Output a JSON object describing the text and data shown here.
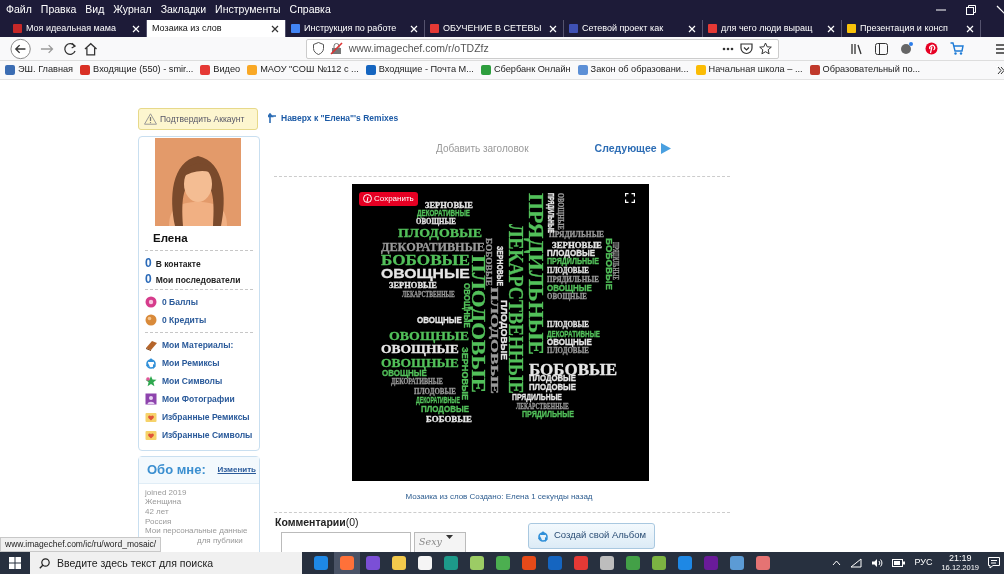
{
  "menu_bar": {
    "items": [
      "Файл",
      "Правка",
      "Вид",
      "Журнал",
      "Закладки",
      "Инструменты",
      "Справка"
    ]
  },
  "tabs": [
    {
      "label": "Моя идеальная мама",
      "selected": false,
      "color": "#c62828"
    },
    {
      "label": "Мозаика из слов",
      "selected": true
    },
    {
      "label": "Инструкция по работе",
      "selected": false,
      "color": "#4285f4"
    },
    {
      "label": "ОБУЧЕНИЕ В СЕТЕВЫ",
      "selected": false,
      "color": "#e53935"
    },
    {
      "label": "Сетевой проект как",
      "selected": false,
      "color": "#3f51b5"
    },
    {
      "label": "для чего люди выращ",
      "selected": false,
      "color": "#e53935"
    },
    {
      "label": "Презентация и консп",
      "selected": false,
      "color": "#f9c20a"
    }
  ],
  "address_bar": {
    "url": "www.imagechef.com/r/oTDZfz"
  },
  "bookmarks": [
    {
      "label": "ЭШ. Главная",
      "color": "#3b6db3"
    },
    {
      "label": "Входящие (550) - smir...",
      "color": "#d93025"
    },
    {
      "label": "Видео",
      "color": "#e53935"
    },
    {
      "label": "МАОУ \"СОШ №112 с ...",
      "color": "#f9a825"
    },
    {
      "label": "Входящие - Почта M...",
      "color": "#1565c0"
    },
    {
      "label": "Сбербанк Онлайн",
      "color": "#2e9e3e"
    },
    {
      "label": "Закон об образовани...",
      "color": "#5c8fd6"
    },
    {
      "label": "Начальная школа – ...",
      "color": "#fbbc04"
    },
    {
      "label": "Образовательный по...",
      "color": "#c0392b"
    }
  ],
  "sidebar": {
    "confirm_button": "Подтвердить Аккаунт",
    "profile": {
      "name": "Елена",
      "stats": [
        {
          "count": "0",
          "label": "В контакте"
        },
        {
          "count": "0",
          "label": "Мои последователи"
        }
      ],
      "points": [
        "0 Баллы",
        "0 Кредиты"
      ],
      "links": [
        "Мои Материалы:",
        "Мои Ремиксы",
        "Мои Символы",
        "Мои Фотографии",
        "Избранные Ремиксы",
        "Избранные Символы"
      ]
    },
    "about": {
      "title": "Обо мне:",
      "edit": "Изменить",
      "lines": [
        "joined 2019",
        "Женщина",
        "42 лет",
        "Россия",
        "Мои персональные данные",
        "для публики"
      ]
    }
  },
  "main": {
    "back_link": "Наверх к \"Елена\"'s Remixes",
    "add_title": "Добавить заголовок",
    "next_link": "Следующее",
    "mosaic": {
      "save_button": "Сохранить",
      "words": [
        {
          "text": "ЗЕРНОВЫЕ",
          "kind": "serif",
          "color": "#e6e6e6"
        },
        {
          "text": "ДЕКОРАТИВНЫЕ",
          "kind": "sans",
          "color": "#52c05a"
        },
        {
          "text": "ОВОЩНЫЕ",
          "kind": "serif",
          "color": "#e6e6e6"
        },
        {
          "text": "ПЛОДОВЫЕ",
          "kind": "serif",
          "color": "#52c05a"
        },
        {
          "text": "ДЕКОРАТИВНЫЕ",
          "kind": "serif",
          "color": "#9a9a9a"
        },
        {
          "text": "БОБОВЫЕ",
          "kind": "serif",
          "color": "#52c05a"
        },
        {
          "text": "ОВОЩНЫЕ",
          "kind": "sans",
          "color": "#e6e6e6"
        },
        {
          "text": "ЗЕРНОВЫЕ",
          "kind": "serif",
          "color": "#e6e6e6"
        },
        {
          "text": "ЛЕКАРСТВЕННЫЕ",
          "kind": "serif",
          "color": "#9a9a9a"
        },
        {
          "text": "ОВОЩНЫЕ",
          "kind": "sans",
          "color": "#e6e6e6"
        },
        {
          "text": "ОВОЩНЫЕ",
          "kind": "serif",
          "color": "#52c05a"
        },
        {
          "text": "ОВОЩНЫЕ",
          "kind": "serif",
          "color": "#e6e6e6"
        },
        {
          "text": "ОВОЩНЫЕ",
          "kind": "serif",
          "color": "#52c05a"
        },
        {
          "text": "ОВОЩНЫЕ",
          "kind": "sans",
          "color": "#52c05a"
        },
        {
          "text": "ДЕКОРАТИВНЫЕ",
          "kind": "serif",
          "color": "#9a9a9a"
        },
        {
          "text": "ПЛОДОВЫЕ",
          "kind": "serif",
          "color": "#9a9a9a"
        },
        {
          "text": "ДЕКОРАТИВНЫЕ",
          "kind": "sans",
          "color": "#52c05a"
        },
        {
          "text": "ПЛОДОВЫЕ",
          "kind": "sans",
          "color": "#52c05a"
        },
        {
          "text": "БОБОВЫЕ",
          "kind": "serif",
          "color": "#e6e6e6"
        },
        {
          "text": "ПРЯДИЛЬНЫЕ",
          "kind": "serif",
          "color": "#9a9a9a"
        },
        {
          "text": "ЗЕРНОВЫЕ",
          "kind": "serif",
          "color": "#e6e6e6"
        },
        {
          "text": "ПЛОДОВЫЕ",
          "kind": "sans",
          "color": "#e6e6e6"
        },
        {
          "text": "ПРЯДИЛЬНЫЕ",
          "kind": "sans",
          "color": "#52c05a"
        },
        {
          "text": "ПЛОДОВЫЕ",
          "kind": "serif",
          "color": "#e6e6e6"
        },
        {
          "text": "ПРЯДИЛЬНЫЕ",
          "kind": "serif",
          "color": "#9a9a9a"
        },
        {
          "text": "ОВОЩНЫЕ",
          "kind": "sans",
          "color": "#52c05a"
        },
        {
          "text": "ОВОЩНЫЕ",
          "kind": "serif",
          "color": "#9a9a9a"
        },
        {
          "text": "ПЛОДОВЫЕ",
          "kind": "serif",
          "color": "#e6e6e6"
        },
        {
          "text": "ДЕКОРАТИВНЫЕ",
          "kind": "sans",
          "color": "#52c05a"
        },
        {
          "text": "ОВОЩНЫЕ",
          "kind": "sans",
          "color": "#e6e6e6"
        },
        {
          "text": "ПЛОДОВЫЕ",
          "kind": "serif",
          "color": "#9a9a9a"
        },
        {
          "text": "БОБОВЫЕ",
          "kind": "serif",
          "color": "#e6e6e6"
        },
        {
          "text": "ПЛОДОВЫЕ",
          "kind": "sans",
          "color": "#e6e6e6"
        },
        {
          "text": "ПЛОДОВЫЕ",
          "kind": "sans",
          "color": "#e6e6e6"
        },
        {
          "text": "ПРЯДИЛЬНЫЕ",
          "kind": "sans",
          "color": "#e6e6e6"
        },
        {
          "text": "ЛЕКАРСТВЕННЫЕ",
          "kind": "serif",
          "color": "#9a9a9a"
        },
        {
          "text": "ПРЯДИЛЬНЫЕ",
          "kind": "sans",
          "color": "#52c05a"
        },
        {
          "text": "ПЛОДОВЫЕ",
          "kind": "serif-vertical",
          "color": "#52c05a"
        },
        {
          "text": "ПЛОДОВЫЕ",
          "kind": "serif-vertical",
          "color": "#9a9a9a"
        },
        {
          "text": "БОБОВЫЕ",
          "kind": "serif-vertical",
          "color": "#9a9a9a"
        },
        {
          "text": "ЗЕРНОВЫЕ",
          "kind": "sans-vertical",
          "color": "#e6e6e6"
        },
        {
          "text": "ОВОЩНЫЕ",
          "kind": "sans-vertical",
          "color": "#52c05a"
        },
        {
          "text": "ЗЕРНОВЫЕ",
          "kind": "sans-vertical",
          "color": "#52c05a"
        },
        {
          "text": "ПЛОДОВЫЕ",
          "kind": "sans-vertical",
          "color": "#e6e6e6"
        },
        {
          "text": "ЛЕКАРСТВЕННЫЕ",
          "kind": "serif-vertical",
          "color": "#52c05a"
        },
        {
          "text": "ПРЯДИЛЬНЫЕ",
          "kind": "serif-vertical",
          "color": "#52c05a"
        },
        {
          "text": "ПРЯДИЛЬНЫЕ",
          "kind": "sans-vertical",
          "color": "#e6e6e6"
        },
        {
          "text": "ОВОЩНЫЕ",
          "kind": "serif-vertical",
          "color": "#9a9a9a"
        },
        {
          "text": "БОБОВЫЕ",
          "kind": "sans-vertical",
          "color": "#52c05a"
        },
        {
          "text": "ПРЯДИЛЬНЫЕ",
          "kind": "serif-vertical",
          "color": "#9a9a9a"
        }
      ]
    },
    "caption": "Мозаика из слов Создано: Елена 1 секунды назад",
    "comments_label": "**Комментарии**(0)",
    "font_select": "Sexy",
    "album_button": "Создай свой Альбом"
  },
  "status_link": "www.imagechef.com/ic/ru/word_mosaic/",
  "taskbar": {
    "search_placeholder": "Введите здесь текст для поиска",
    "apps": [
      {
        "color": "#1e88e5",
        "selected": false
      },
      {
        "color": "#ff7139",
        "selected": true
      },
      {
        "color": "#7b4fd6",
        "selected": false
      },
      {
        "color": "#f2c94c",
        "selected": false
      },
      {
        "color": "#f5f5f5",
        "selected": false
      },
      {
        "color": "#1d9a8a",
        "selected": false
      },
      {
        "color": "#9ccc65",
        "selected": false
      },
      {
        "color": "#4caf50",
        "selected": false
      },
      {
        "color": "#e64a19",
        "selected": false
      },
      {
        "color": "#1565c0",
        "selected": false
      },
      {
        "color": "#e53935",
        "selected": false
      },
      {
        "color": "#bdbdbd",
        "selected": false
      },
      {
        "color": "#43a047",
        "selected": false
      },
      {
        "color": "#7cb342",
        "selected": false
      },
      {
        "color": "#1e88e5",
        "selected": false
      },
      {
        "color": "#6a1b9a",
        "selected": false
      },
      {
        "color": "#5c9bd5",
        "selected": false
      },
      {
        "color": "#e57373",
        "selected": false
      }
    ],
    "language": "РУС",
    "time": "21:19",
    "date": "16.12.2019"
  }
}
